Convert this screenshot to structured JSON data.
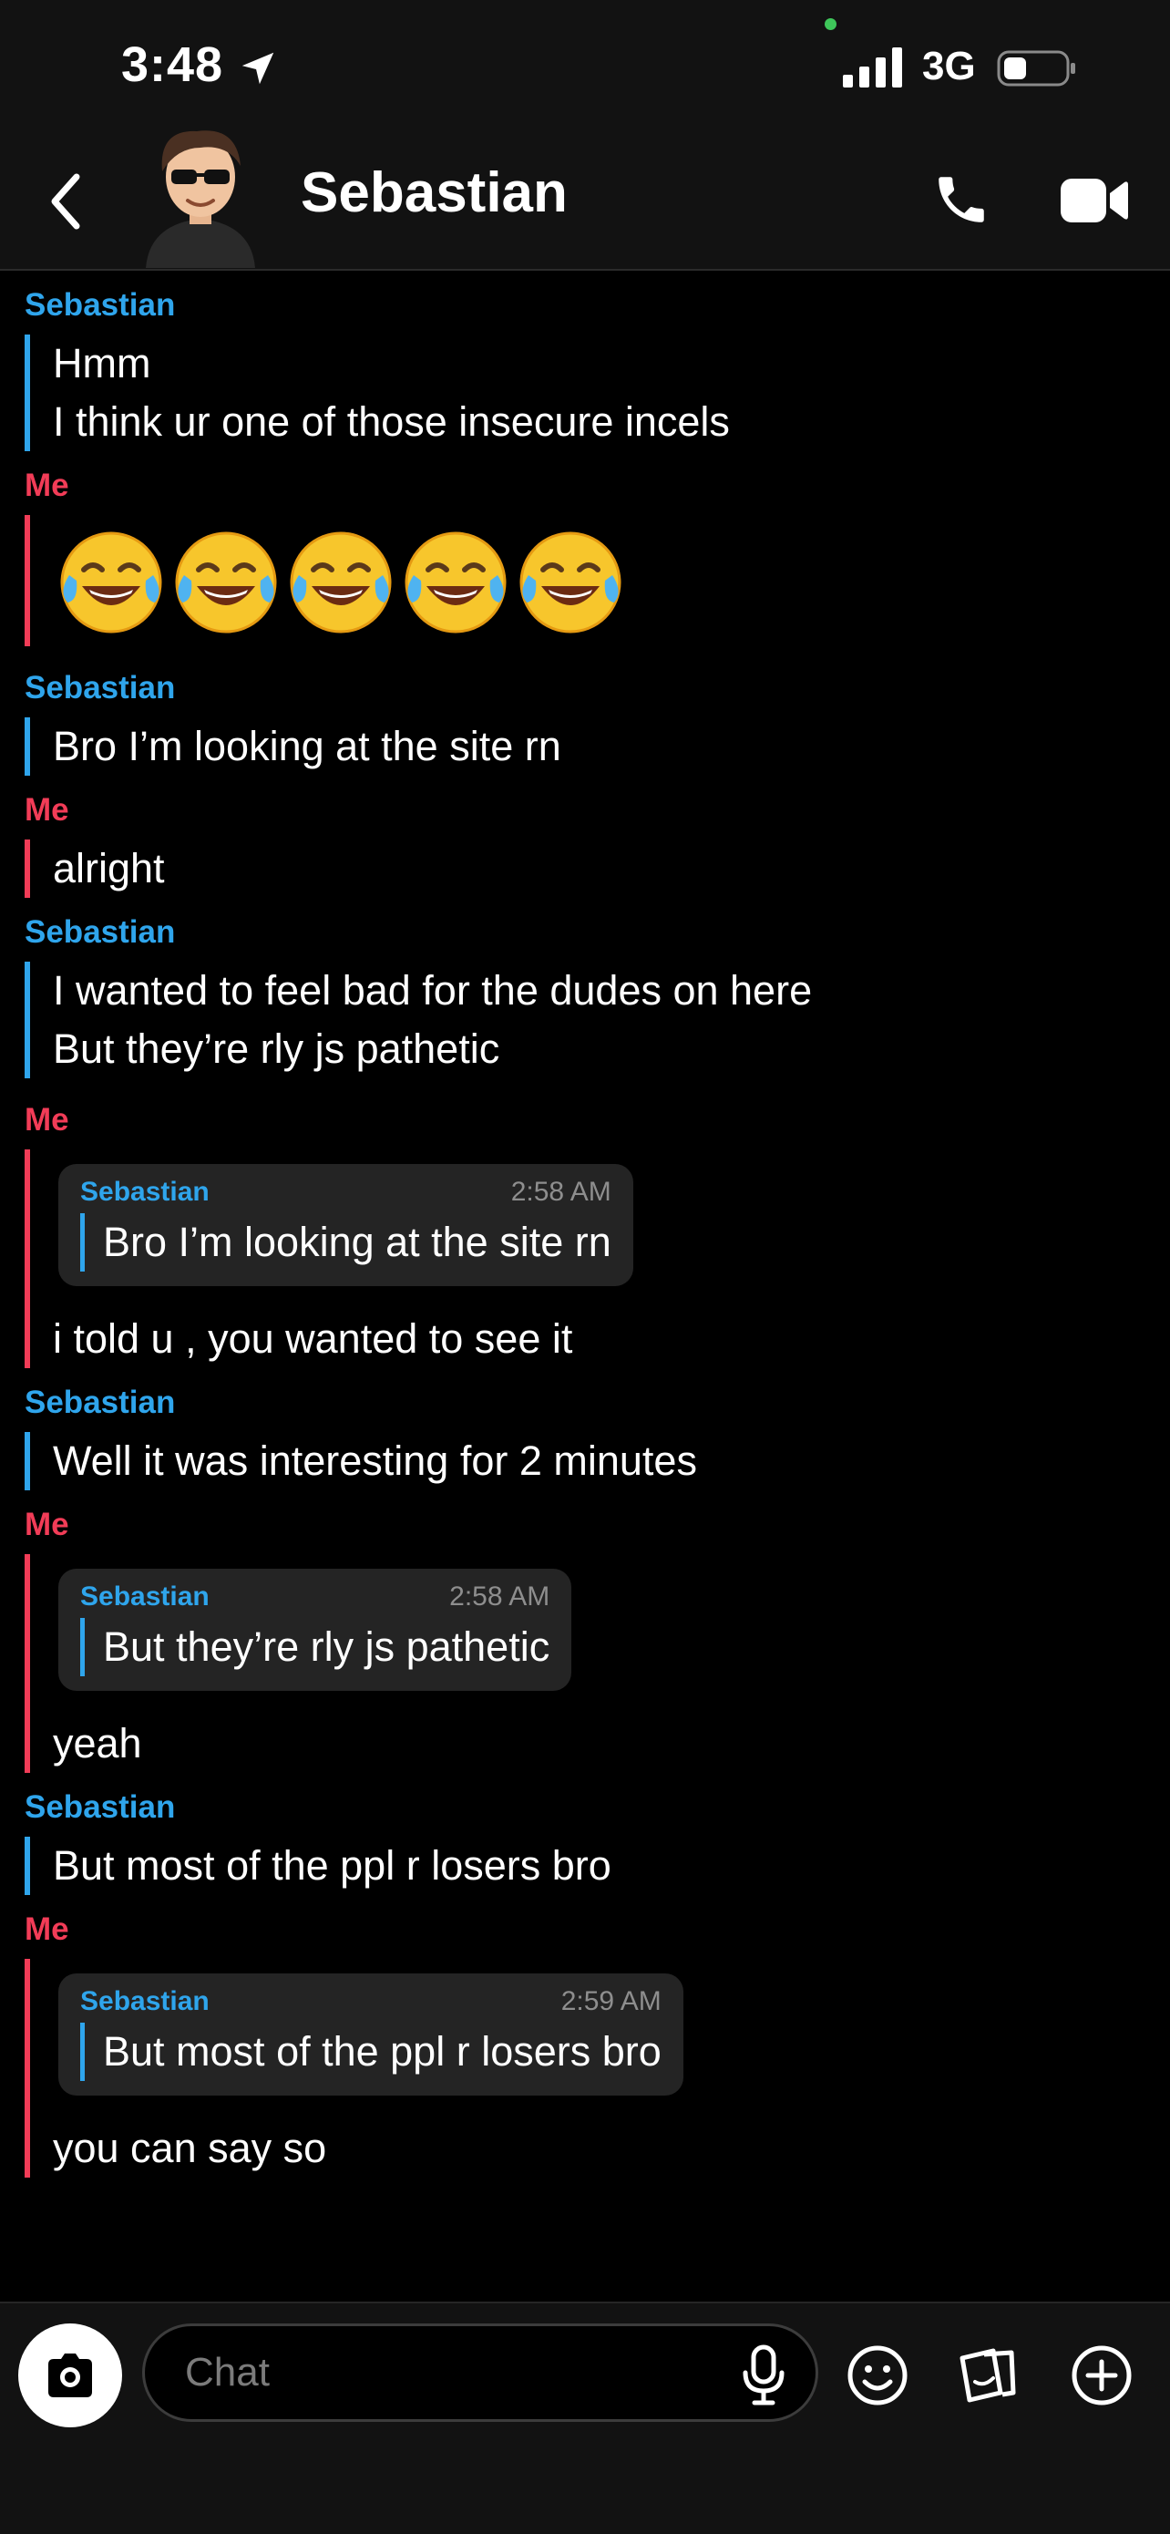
{
  "status": {
    "time": "3:48",
    "network": "3G"
  },
  "header": {
    "contact_name": "Sebastian"
  },
  "colors": {
    "them": "#2fa5ec",
    "me": "#f23c57",
    "background": "#000000"
  },
  "messages": [
    {
      "sender": "Sebastian",
      "lines": [
        "Hmm",
        "I think ur one of those insecure incels"
      ]
    },
    {
      "sender": "Me",
      "emoji": "face-with-tears-of-joy",
      "emoji_count": 5
    },
    {
      "sender": "Sebastian",
      "lines": [
        "Bro I’m looking at the site rn"
      ]
    },
    {
      "sender": "Me",
      "lines": [
        "alright"
      ]
    },
    {
      "sender": "Sebastian",
      "lines": [
        "I wanted to feel bad for the dudes on here",
        "But they’re rly js pathetic"
      ]
    },
    {
      "sender": "Me",
      "quote": {
        "name": "Sebastian",
        "time": "2:58 AM",
        "text": "Bro I’m looking at the site rn"
      },
      "lines": [
        "i told u , you wanted to see it"
      ]
    },
    {
      "sender": "Sebastian",
      "lines": [
        "Well it was interesting for 2 minutes"
      ]
    },
    {
      "sender": "Me",
      "quote": {
        "name": "Sebastian",
        "time": "2:58 AM",
        "text": "But they’re rly js pathetic"
      },
      "lines": [
        "yeah"
      ]
    },
    {
      "sender": "Sebastian",
      "lines": [
        "But most of the ppl r losers bro"
      ]
    },
    {
      "sender": "Me",
      "quote": {
        "name": "Sebastian",
        "time": "2:59 AM",
        "text": "But most of the ppl r losers bro"
      },
      "lines": [
        "you can say so"
      ]
    }
  ],
  "composer": {
    "placeholder": "Chat"
  }
}
